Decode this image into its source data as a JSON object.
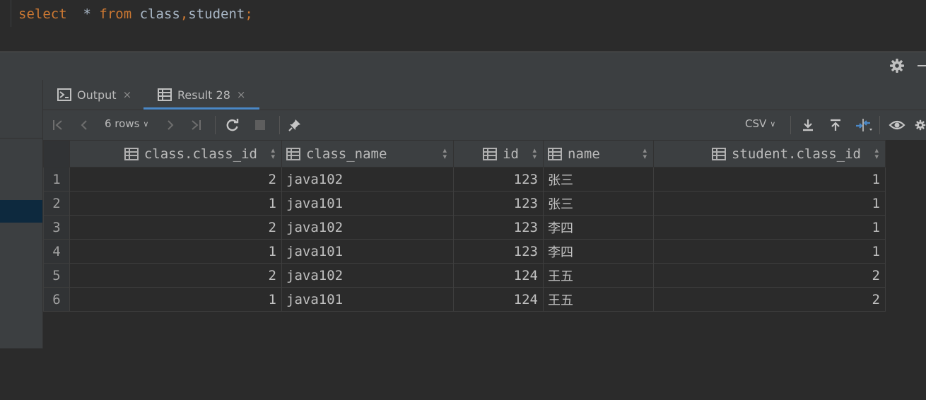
{
  "editor": {
    "tokens": [
      "select",
      "  * ",
      "from",
      " class",
      ",",
      "student",
      ";"
    ]
  },
  "tabs": [
    {
      "label": "Output",
      "close": "×"
    },
    {
      "label": "Result 28",
      "close": "×"
    }
  ],
  "toolbar": {
    "rows_label": "6 rows",
    "rows_chevron": "∨",
    "export_format": "CSV",
    "export_chevron": "∨"
  },
  "table": {
    "columns": [
      "class.class_id",
      "class_name",
      "id",
      "name",
      "student.class_id"
    ],
    "rows": [
      {
        "n": "1",
        "class_id": "2",
        "class_name": "java102",
        "id": "123",
        "name": "张三",
        "student_class_id": "1"
      },
      {
        "n": "2",
        "class_id": "1",
        "class_name": "java101",
        "id": "123",
        "name": "张三",
        "student_class_id": "1"
      },
      {
        "n": "3",
        "class_id": "2",
        "class_name": "java102",
        "id": "123",
        "name": "李四",
        "student_class_id": "1"
      },
      {
        "n": "4",
        "class_id": "1",
        "class_name": "java101",
        "id": "123",
        "name": "李四",
        "student_class_id": "1"
      },
      {
        "n": "5",
        "class_id": "2",
        "class_name": "java102",
        "id": "124",
        "name": "王五",
        "student_class_id": "2"
      },
      {
        "n": "6",
        "class_id": "1",
        "class_name": "java101",
        "id": "124",
        "name": "王五",
        "student_class_id": "2"
      }
    ]
  },
  "colors": {
    "keyword": "#cc7832",
    "identifier": "#a9b7c6",
    "accent": "#4a88c7",
    "selection": "#0d293e"
  }
}
